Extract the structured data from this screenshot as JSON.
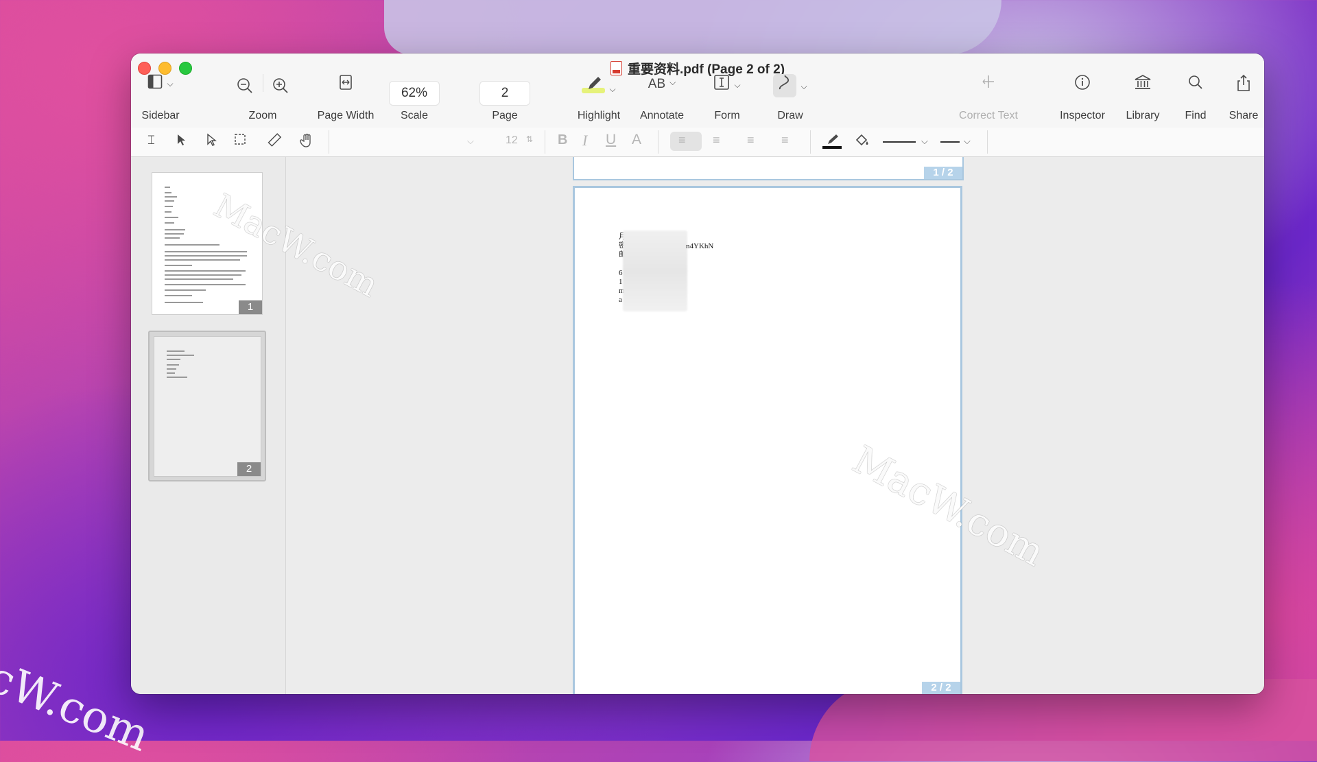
{
  "window": {
    "title": "重要资料.pdf (Page 2 of 2)"
  },
  "toolbar": {
    "sidebar_label": "Sidebar",
    "zoom_label": "Zoom",
    "page_width_label": "Page Width",
    "scale_value": "62%",
    "scale_label": "Scale",
    "page_value": "2",
    "page_label": "Page",
    "highlight_label": "Highlight",
    "annotate_icon_text": "AB",
    "annotate_label": "Annotate",
    "form_label": "Form",
    "draw_label": "Draw",
    "correct_text_label": "Correct Text",
    "inspector_label": "Inspector",
    "library_label": "Library",
    "find_label": "Find",
    "share_label": "Share"
  },
  "format_bar": {
    "font_size": "12",
    "bold": "B",
    "italic": "I",
    "underline": "U",
    "text_color": "A"
  },
  "sidebar": {
    "thumbnails": [
      {
        "number": "1"
      },
      {
        "number": "2"
      }
    ],
    "thumbnail_size_fraction": 0.9
  },
  "document": {
    "page1_badge": "1 / 2",
    "page2_badge": "2 / 2",
    "text_lines": [
      "月",
      "密",
      "邮",
      "6",
      "1",
      "m",
      "a"
    ],
    "visible_fragment": "n4YKhN"
  },
  "watermarks": {
    "text": "MacW.com",
    "corner_text": "cW.com"
  },
  "colors": {
    "highlight": "#e6f27a",
    "slider": "#3bb340",
    "page_border": "#a9c7df"
  }
}
